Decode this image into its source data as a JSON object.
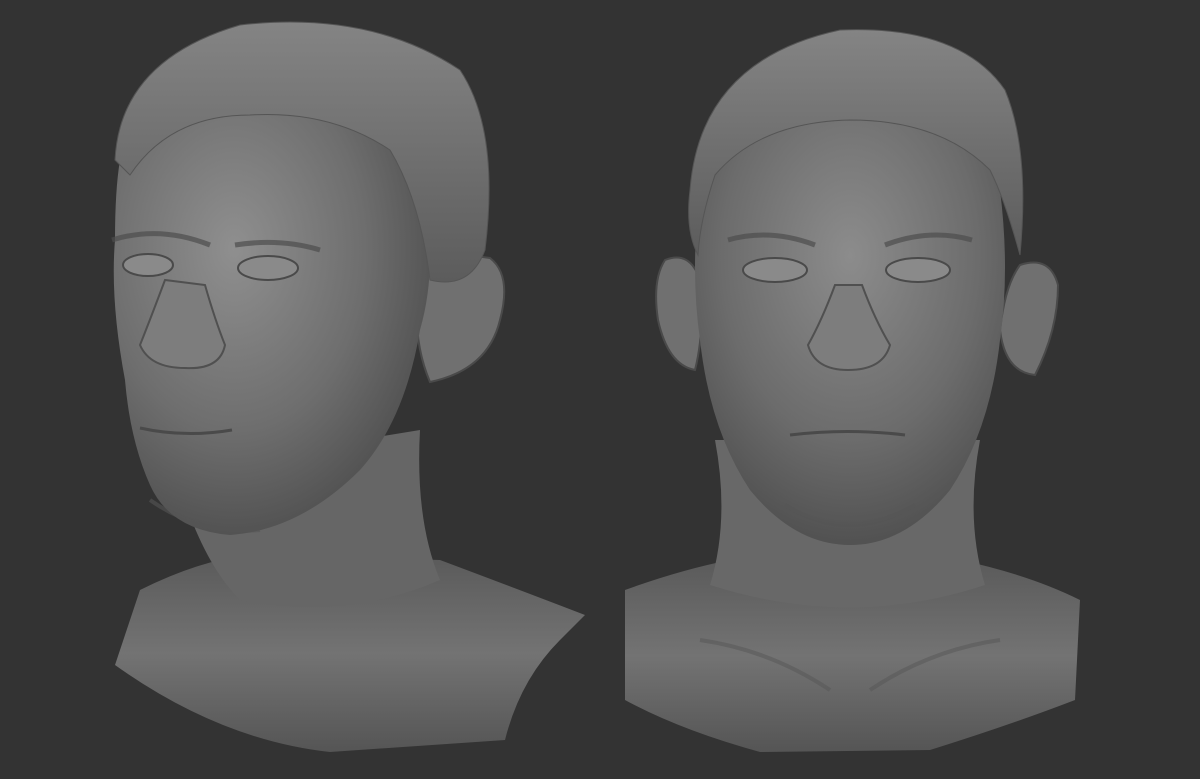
{
  "scene": {
    "background_color": "#333333",
    "material_color": "#7a7a7a",
    "subjects": [
      {
        "name": "sculpt-three-quarter-view",
        "view": "three-quarter"
      },
      {
        "name": "sculpt-front-view",
        "view": "front"
      }
    ]
  }
}
